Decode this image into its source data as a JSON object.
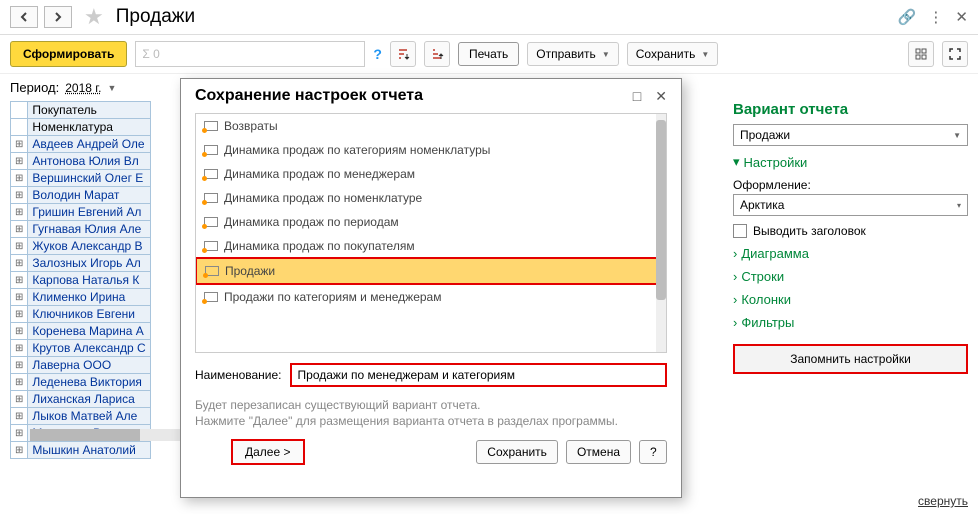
{
  "header": {
    "title": "Продажи"
  },
  "toolbar": {
    "generate": "Сформировать",
    "sigma_placeholder": "Σ 0",
    "print": "Печать",
    "send": "Отправить",
    "save": "Сохранить"
  },
  "period": {
    "label": "Период:",
    "value": "2018 г."
  },
  "table": {
    "headers": [
      "Покупатель",
      "Номенклатура"
    ],
    "rows": [
      "Авдеев Андрей Оле",
      "Антонова Юлия Вл",
      "Вершинский Олег Е",
      "Володин Марат",
      "Гришин Евгений Ал",
      "Гугнавая Юлия Але",
      "Жуков Александр В",
      "Залозных Игорь Ал",
      "Карпова Наталья К",
      "Клименко Ирина",
      "Ключников Евгени",
      "Коренева Марина А",
      "Крутов Александр С",
      "Лаверна ООО",
      "Леденева Виктория",
      "Лиханская Лариса",
      "Лыков Матвей Але",
      "Младенце Вячесла",
      "Мышкин Анатолий"
    ]
  },
  "dialog": {
    "title": "Сохранение настроек отчета",
    "items": [
      "Возвраты",
      "Динамика продаж по категориям номенклатуры",
      "Динамика продаж по менеджерам",
      "Динамика продаж по номенклатуре",
      "Динамика продаж по периодам",
      "Динамика продаж по покупателям",
      "Продажи",
      "Продажи по категориям и менеджерам"
    ],
    "selected_index": 6,
    "name_label": "Наименование:",
    "name_value": "Продажи по менеджерам и категориям",
    "warning": "Будет перезаписан существующий вариант отчета.\nНажмите \"Далее\" для размещения варианта отчета в разделах программы.",
    "next": "Далее  >",
    "save": "Сохранить",
    "cancel": "Отмена",
    "help": "?"
  },
  "side": {
    "variant_title": "Вариант отчета",
    "variant_value": "Продажи",
    "settings": "Настройки",
    "style_label": "Оформление:",
    "style_value": "Арктика",
    "show_header": "Выводить заголовок",
    "diagram": "Диаграмма",
    "rows": "Строки",
    "columns": "Колонки",
    "filters": "Фильтры",
    "remember": "Запомнить настройки",
    "collapse": "свернуть"
  }
}
